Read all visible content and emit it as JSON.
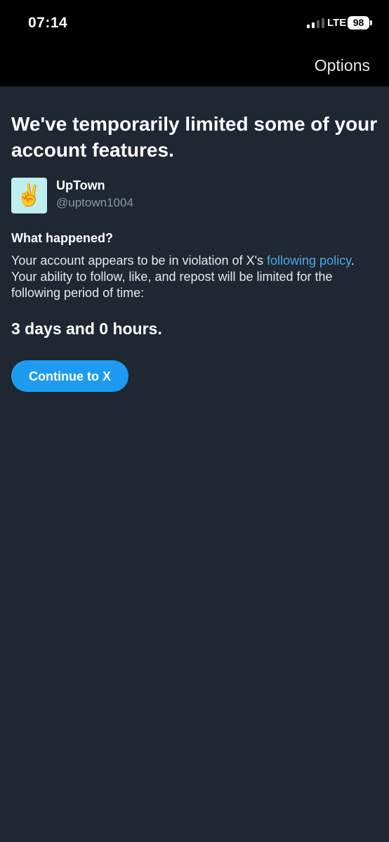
{
  "status_bar": {
    "time": "07:14",
    "network": "LTE",
    "battery": "98",
    "signal_bars_active": 2,
    "signal_bars_total": 4
  },
  "nav": {
    "options_label": "Options"
  },
  "headline": "We've temporarily limited some of your account features.",
  "account": {
    "display_name": "UpTown",
    "handle": "@uptown1004",
    "avatar_emoji": "✌️"
  },
  "what_happened": {
    "title": "What happened?",
    "text_before_link": "Your account appears to be in violation of X's ",
    "link_text": "following policy",
    "text_after_link": ". Your ability to follow, like, and repost will be limited for the following period of time:"
  },
  "duration": "3 days and 0 hours.",
  "continue_button": {
    "label": "Continue to X"
  },
  "colors": {
    "background": "#1e2732",
    "status_bar": "#000000",
    "accent": "#1d9bf0",
    "link": "#4ea8e7",
    "secondary_text": "#8b98a5"
  }
}
